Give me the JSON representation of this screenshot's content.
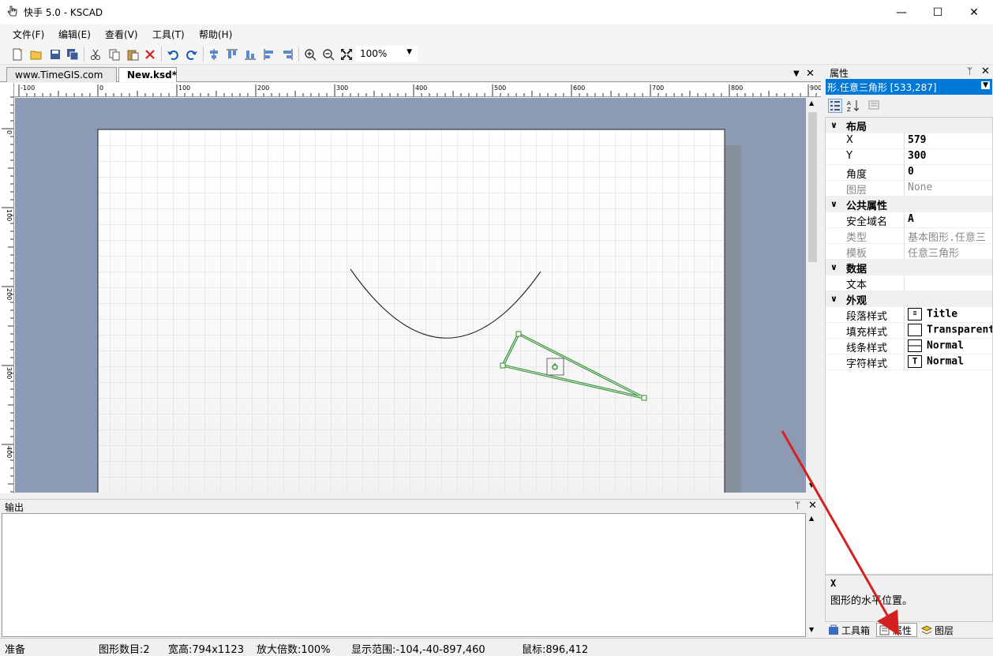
{
  "window": {
    "title": "快手 5.0 - KSCAD",
    "minimize_glyph": "—",
    "maximize_glyph": "☐",
    "close_glyph": "✕"
  },
  "menu": [
    "文件(F)",
    "编辑(E)",
    "查看(V)",
    "工具(T)",
    "帮助(H)"
  ],
  "toolbar": {
    "icons": [
      "new-file-icon",
      "open-folder-icon",
      "save-icon",
      "save-all-icon",
      "cut-icon",
      "copy-icon",
      "paste-icon",
      "delete-icon",
      "undo-icon",
      "redo-icon",
      "align-center-icon",
      "align-top-icon",
      "align-bottom-icon",
      "align-left-icon",
      "align-right-icon",
      "zoom-in-icon",
      "zoom-out-icon",
      "fit-icon"
    ],
    "zoom_value": "100%"
  },
  "tabs": [
    {
      "label": "www.TimeGIS.com",
      "active": false
    },
    {
      "label": "New.ksd*",
      "active": true
    }
  ],
  "ruler": {
    "top_labels": [
      "-100",
      "0",
      "100",
      "200",
      "300",
      "400",
      "500",
      "600",
      "700",
      "800",
      "900"
    ],
    "left_labels": [
      "0",
      "100",
      "200",
      "300",
      "400"
    ]
  },
  "output": {
    "title": "输出",
    "pin_glyph": "ᛘ",
    "close_glyph": "✕"
  },
  "properties": {
    "title": "属性",
    "selected_object": "形.任意三角形 [533,287]",
    "categories": [
      {
        "name": "布局",
        "items": [
          {
            "label": "X",
            "value": "579",
            "dim": false
          },
          {
            "label": "Y",
            "value": "300",
            "dim": false
          },
          {
            "label": "角度",
            "value": "0",
            "dim": false
          },
          {
            "label": "图层",
            "value": "None",
            "dim": true
          }
        ]
      },
      {
        "name": "公共属性",
        "items": [
          {
            "label": "安全域名",
            "value": "A",
            "dim": false
          },
          {
            "label": "类型",
            "value": "基本图形.任意三",
            "dim": true
          },
          {
            "label": "模板",
            "value": "任意三角形",
            "dim": true
          }
        ]
      },
      {
        "name": "数据",
        "items": [
          {
            "label": "文本",
            "value": "",
            "dim": false
          }
        ]
      },
      {
        "name": "外观",
        "items": [
          {
            "label": "段落样式",
            "value": "Title",
            "swatch": "paragraph"
          },
          {
            "label": "填充样式",
            "value": "Transparent",
            "swatch": "fill"
          },
          {
            "label": "线条样式",
            "value": "Normal",
            "swatch": "line"
          },
          {
            "label": "字符样式",
            "value": "Normal",
            "swatch": "char"
          }
        ]
      }
    ],
    "description": {
      "title": "X",
      "text": "图形的水平位置。"
    },
    "bottom_tabs": [
      "工具箱",
      "属性",
      "图层"
    ]
  },
  "status": {
    "ready": "准备",
    "shape_count": "图形数目:2",
    "size": "宽高:794x1123",
    "zoom": "放大倍数:100%",
    "display_range": "显示范围:-104,-40-897,460",
    "mouse": "鼠标:896,412"
  },
  "colors": {
    "selection_green": "#2e8b2e",
    "canvas_bg": "#8c9bb3",
    "annotation_red": "#d42020",
    "select_blue": "#0078d7"
  }
}
